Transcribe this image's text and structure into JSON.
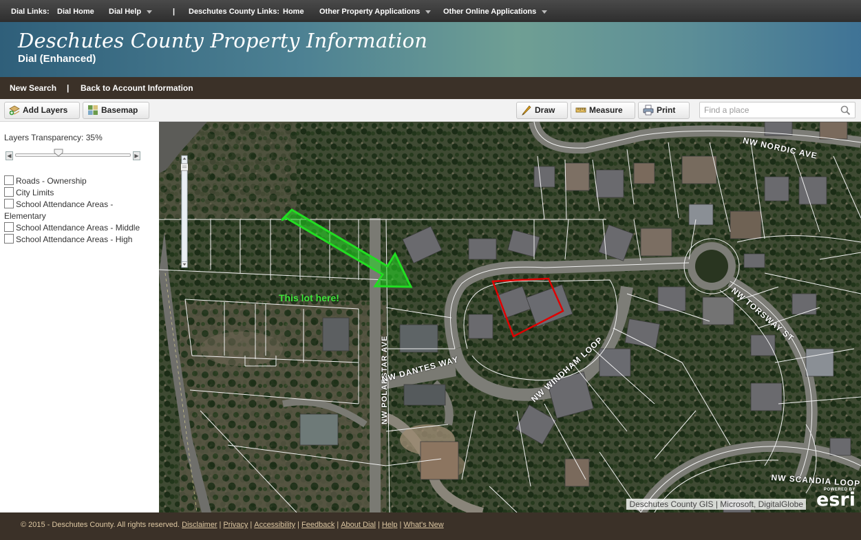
{
  "topnav": {
    "dial_links_label": "Dial Links:",
    "dial_home": "Dial Home",
    "dial_help": "Dial Help",
    "separator": "|",
    "county_links_label": "Deschutes County Links:",
    "home": "Home",
    "other_property_apps": "Other Property Applications",
    "other_online_apps": "Other Online Applications"
  },
  "banner": {
    "title": "Deschutes County Property Information",
    "subtitle": "Dial (Enhanced)"
  },
  "account_bar": {
    "new_search": "New Search",
    "separator": "|",
    "back_to_account": "Back to Account Information"
  },
  "toolbar": {
    "add_layers": "Add Layers",
    "basemap": "Basemap",
    "draw": "Draw",
    "measure": "Measure",
    "print": "Print",
    "search_placeholder": "Find a place"
  },
  "left_panel": {
    "transparency_label": "Layers Transparency: 35%",
    "transparency_value": 0.35,
    "layers": [
      {
        "label": "Roads - Ownership",
        "checked": false
      },
      {
        "label": "City Limits",
        "checked": false
      },
      {
        "label": "School Attendance Areas - Elementary",
        "checked": false
      },
      {
        "label": "School Attendance Areas - Middle",
        "checked": false
      },
      {
        "label": "School Attendance Areas - High",
        "checked": false
      }
    ]
  },
  "map": {
    "annotation": "This lot here!",
    "streets": {
      "nordic": "NW NORDIC AVE",
      "torsway": "NW TORSWAY ST",
      "polarstar": "NW POLARSTAR AVE",
      "dantes": "NW DANTES WAY",
      "windham": "NW WINDHAM LOOP",
      "scandia": "NW SCANDIA LOOP"
    },
    "attribution": "Deschutes County GIS | Microsoft, DigitalGlobe",
    "esri_powered": "POWERED BY",
    "esri_logo": "esri",
    "colors": {
      "arrow": "#22dd22",
      "parcel_highlight": "#e00000",
      "parcel_lines": "#f2f2f2"
    }
  },
  "footer": {
    "copyright": "© 2015 - Deschutes County. All rights reserved.",
    "links": [
      "Disclaimer",
      "Privacy",
      "Accessibility",
      "Feedback",
      "About Dial",
      "Help",
      "What's New"
    ],
    "separator": "|"
  }
}
